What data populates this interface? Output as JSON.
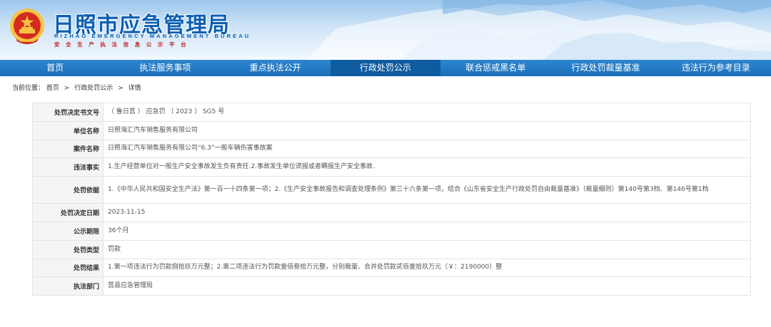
{
  "header": {
    "title_cn": "日照市应急管理局",
    "title_en": "RIZHAO EMERGENCY MANAGEMENT BUREAU",
    "subtitle": "安全生产执法信息公示平台"
  },
  "nav": {
    "items": [
      "首页",
      "执法服务事项",
      "重点执法公开",
      "行政处罚公示",
      "联合惩戒黑名单",
      "行政处罚裁量基准",
      "违法行为参考目录"
    ],
    "active_index": 3
  },
  "breadcrumb": {
    "prefix": "当前位置：",
    "items": [
      "首页",
      "行政处罚公示",
      "详情"
    ],
    "separator": ">"
  },
  "detail": {
    "rows": [
      {
        "label": "处罚决定书文号",
        "value": "（ 鲁日莒 ） 应急罚 〔 2023 〕 SG5 号"
      },
      {
        "label": "单位名称",
        "value": "日照海汇汽车销售服务有限公司"
      },
      {
        "label": "案件名称",
        "value": "日照海汇汽车销售服务有限公司“6.3”一般车辆伤害事故案"
      },
      {
        "label": "违法事实",
        "value": "1.生产经营单位对一般生产安全事故发生负有责任.2.事故发生单位谎报或者瞒报生产安全事故."
      },
      {
        "label": "处罚依据",
        "value": "1.《中华人民共和国安全生产法》第一百一十四条第一项；2.《生产安全事故报告和调查处理条例》第三十六条第一项，结合《山东省安全生产行政处罚自由裁量基准》（裁量细则）第140号第3档、第146号第1档"
      },
      {
        "label": "处罚决定日期",
        "value": "2023-11-15"
      },
      {
        "label": "公示期限",
        "value": "36个月"
      },
      {
        "label": "处罚类型",
        "value": "罚款"
      },
      {
        "label": "处罚结果",
        "value": "1.第一项违法行为罚款捌拾玖万元整；2.第二项违法行为罚款壹佰叁拾万元整，分别裁量、合并处罚款贰佰壹拾玖万元（￥：2190000）整"
      },
      {
        "label": "执法部门",
        "value": "莒县应急管理局"
      }
    ]
  },
  "colors": {
    "brand_blue": "#0c5fb2",
    "nav_bg": "#1b6fb8",
    "nav_active": "#0f5ba0",
    "emblem_red": "#d52b1e",
    "emblem_gold": "#f6c344"
  }
}
